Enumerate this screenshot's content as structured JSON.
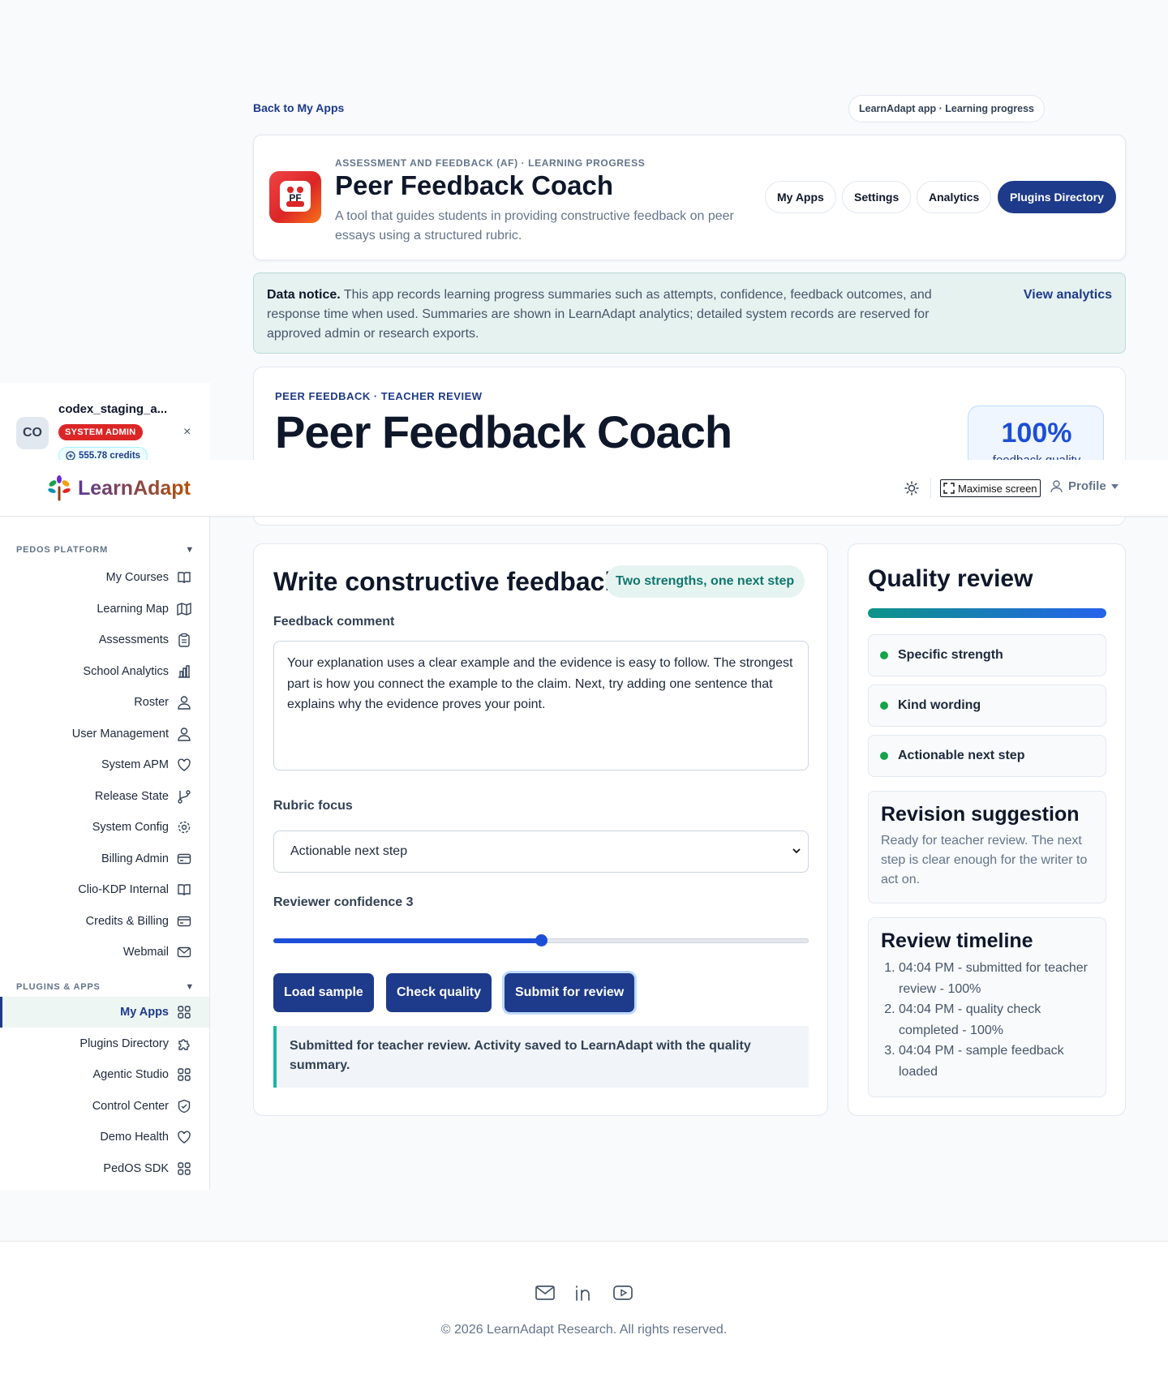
{
  "nav": {
    "back_label": "Back to My Apps",
    "context_chip": "LearnAdapt app · Learning progress"
  },
  "app_header": {
    "kicker": "ASSESSMENT AND FEEDBACK (AF) · LEARNING PROGRESS",
    "title": "Peer Feedback Coach",
    "logo_text": "PF",
    "description": "A tool that guides students in providing constructive feedback on peer essays using a structured rubric.",
    "buttons": {
      "my_apps": "My Apps",
      "settings": "Settings",
      "analytics": "Analytics",
      "plugins_directory": "Plugins Directory"
    }
  },
  "notice": {
    "lead": "Data notice.",
    "text": " This app records learning progress summaries such as attempts, confidence, feedback outcomes, and response time when used. Summaries are shown in LearnAdapt analytics; detailed system records are reserved for approved admin or research exports.",
    "link": "View analytics"
  },
  "hero": {
    "kicker": "PEER FEEDBACK · TEACHER REVIEW",
    "title": "Peer Feedback Coach",
    "stat_value": "100%",
    "stat_label": "feedback quality"
  },
  "topbar": {
    "brand": "LearnAdapt",
    "maximise": "Maximise screen",
    "profile": "Profile"
  },
  "user": {
    "initials": "CO",
    "name": "codex_staging_a...",
    "role": "SYSTEM ADMIN",
    "credits": "555.78 credits",
    "close": "×"
  },
  "sidebar": {
    "sections": [
      {
        "title": "PEDOS PLATFORM"
      },
      {
        "title": "PLUGINS & APPS"
      }
    ],
    "platform_items": [
      {
        "label": "My Courses",
        "icon": "book-icon"
      },
      {
        "label": "Learning Map",
        "icon": "map-icon"
      },
      {
        "label": "Assessments",
        "icon": "clipboard-icon"
      },
      {
        "label": "School Analytics",
        "icon": "bar-chart-icon"
      },
      {
        "label": "Roster",
        "icon": "users-icon"
      },
      {
        "label": "User Management",
        "icon": "users-icon"
      },
      {
        "label": "System APM",
        "icon": "heart-icon"
      },
      {
        "label": "Release State",
        "icon": "git-branch-icon"
      },
      {
        "label": "System Config",
        "icon": "gear-icon"
      },
      {
        "label": "Billing Admin",
        "icon": "card-icon"
      },
      {
        "label": "Clio-KDP Internal",
        "icon": "book-icon"
      },
      {
        "label": "Credits & Billing",
        "icon": "card-icon"
      },
      {
        "label": "Webmail",
        "icon": "mail-icon"
      }
    ],
    "apps_items": [
      {
        "label": "My Apps",
        "icon": "grid-icon",
        "active": true
      },
      {
        "label": "Plugins Directory",
        "icon": "puzzle-icon"
      },
      {
        "label": "Agentic Studio",
        "icon": "grid-icon"
      },
      {
        "label": "Control Center",
        "icon": "shield-icon"
      },
      {
        "label": "Demo Health",
        "icon": "heart-icon"
      },
      {
        "label": "PedOS SDK",
        "icon": "grid-icon"
      }
    ]
  },
  "form": {
    "title": "Write constructive feedback",
    "chip": "Two strengths, one next step",
    "comment_label": "Feedback comment",
    "comment_value": "Your explanation uses a clear example and the evidence is easy to follow. The strongest part is how you connect the example to the claim. Next, try adding one sentence that explains why the evidence proves your point.",
    "rubric_label": "Rubric focus",
    "rubric_value": "Actionable next step",
    "confidence_label": "Reviewer confidence 3",
    "confidence_value": 3,
    "confidence_min": 1,
    "confidence_max": 5,
    "btn_load": "Load sample",
    "btn_check": "Check quality",
    "btn_submit": "Submit for review",
    "status": "Submitted for teacher review. Activity saved to LearnAdapt with the quality summary."
  },
  "quality": {
    "title": "Quality review",
    "progress": 1.0,
    "checks": [
      "Specific strength",
      "Kind wording",
      "Actionable next step"
    ],
    "revision_title": "Revision suggestion",
    "revision_text": "Ready for teacher review. The next step is clear enough for the writer to act on.",
    "timeline_title": "Review timeline",
    "timeline": [
      "04:04 PM - submitted for teacher review - 100%",
      "04:04 PM - quality check completed - 100%",
      "04:04 PM - sample feedback loaded"
    ]
  },
  "footer": {
    "icons": [
      "mail-icon",
      "linkedin-icon",
      "youtube-icon"
    ],
    "copyright": "© 2026 LearnAdapt Research. All rights reserved."
  },
  "colors": {
    "primary": "#1e3a8a",
    "accent_teal": "#0f766e",
    "success": "#16a34a",
    "danger": "#dc2626"
  }
}
